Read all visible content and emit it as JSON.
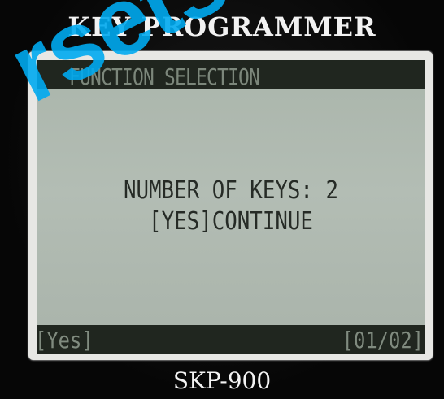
{
  "device": {
    "brand": "KEY PROGRAMMER",
    "model": "SKP-900"
  },
  "screen": {
    "header_title": "FUNCTION SELECTION",
    "body_lines": [
      "NUMBER OF KEYS: 2",
      "[YES]CONTINUE"
    ],
    "footer_left": "[Yes]",
    "footer_right": "[01/02]"
  },
  "watermark": {
    "text": "rsets.co",
    "color": "#00aaf0"
  },
  "colors": {
    "lcd_background": "#b0bab1",
    "lcd_bar": "#20261f",
    "lcd_text": "#262b26"
  }
}
